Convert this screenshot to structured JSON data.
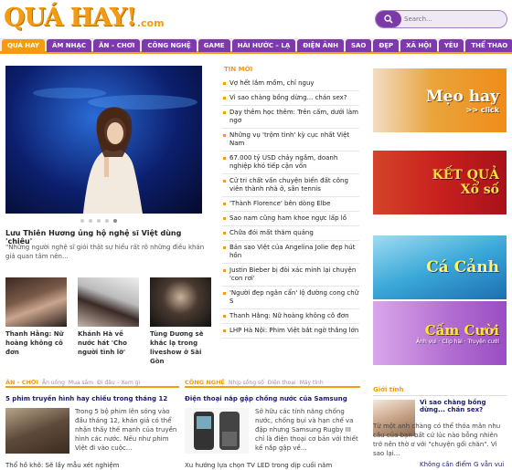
{
  "logo": {
    "main": "QUÁ HAY!",
    "tld": ".com"
  },
  "search": {
    "placeholder": "Search..."
  },
  "nav": [
    "QUÁ HAY",
    "ÂM NHẠC",
    "ĂN – CHƠI",
    "CÔNG NGHỆ",
    "GAME",
    "HÀI HƯỚC – LẠ",
    "ĐIỆN ẢNH",
    "SAO",
    "ĐẸP",
    "XÃ HỘI",
    "YÊU",
    "THỂ THAO"
  ],
  "feature": {
    "title": "Lưu Thiên Hương ủng hộ nghệ sĩ Việt dùng 'chiêu'",
    "desc": "\"Những người nghệ sĩ giỏi thật sự hiểu rất rõ những điều khán giả quan tâm nên..."
  },
  "thumbs": [
    {
      "caption": "Thanh Hằng: Nữ hoàng không cô đơn"
    },
    {
      "caption": "Khánh Hà về nước hát 'Cho người tình lỡ'"
    },
    {
      "caption": "Tùng Dương sẽ khắc lạ trong liveshow ở Sài Gòn"
    }
  ],
  "tinmoi": {
    "heading": "TIN MỚI",
    "items": [
      "Vợ hết lắm mồm, chỉ nguy",
      "Vì sao chàng bồng dừng... chán sex?",
      "Dạy thêm học thêm: Trên cấm, dưới làm ngơ",
      "Những vụ 'trộm tình' kỳ cục nhất Việt Nam",
      "67.000 tỷ USD chảy ngầm, doanh nghiệp khó tiếp cận vốn",
      "Cử tri chất vấn chuyện biển đất công viên thành nhà ở, sân tennis",
      "'Thành Florence' bên dòng Elbe",
      "Sao nam cũng ham khoe ngực lấp lồ",
      "Chữa đói mất thăm quảng",
      "Bản sao Việt của Angelina Jolie đẹp hút hồn",
      "Justin Bieber bị đòi xác minh lại chuyện 'con rơi'",
      "'Người đẹp ngân cẩn' lộ đường cong chữ S",
      "Thanh Hằng: Nữ hoàng không cô đơn",
      "LHP Hà Nội: Phim Việt bắt ngờ thắng lớn"
    ]
  },
  "banners": [
    {
      "text": "Mẹo hay",
      "sub": ">> click"
    },
    {
      "text": "KẾT QUẢ Xổ số",
      "sub": ""
    },
    {
      "text": "Cá Cảnh",
      "sub": ""
    },
    {
      "text": "Cấm Cười",
      "sub": "Ảnh vui · Clip hài · Truyện cười"
    }
  ],
  "section1": {
    "main": "ĂN - CHƠI",
    "subs": [
      "Ăn uống",
      "Mua sắm",
      "Đi đâu – Xem gì"
    ],
    "title": "5 phim truyền hình hay chiếu trong tháng 12",
    "body": "Trong 5 bộ phim lên sóng vào đầu tháng 12, khán giả có thể nhận thấy thế mạnh của truyền hình các nước. Nếu như phim Việt đi vào cuộc...",
    "more": "Thổ hồ khô: Sẽ lầy mẫu xét nghiệm"
  },
  "section2": {
    "main": "CÔNG NGHỆ",
    "subs": [
      "Nhịp sống số",
      "Điện thoại",
      "Máy tính"
    ],
    "title": "Điện thoại nắp gập chống nước của Samsung",
    "body": "Sở hữu các tính năng chống nước, chống bụi và hạn chế va đập nhưng Samsung Rugby III chỉ là điện thoại cơ bản với thiết kế nắp gập về...",
    "more": "Xu hướng lựa chọn TV LED trong dịp cuối năm"
  },
  "gioitinh": {
    "heading": "Giới tính",
    "title": "Vì sao chàng bồng dừng... chán sex?",
    "body": "Từ một anh chàng có thể thỏa mãn nhu cầu của bạn bất cứ lúc nào bỗng nhiên trở nên thờ ơ với \"chuyện gối chăn\". Vì sao lại...",
    "more": "Không cần điểm G vẫn vui"
  }
}
